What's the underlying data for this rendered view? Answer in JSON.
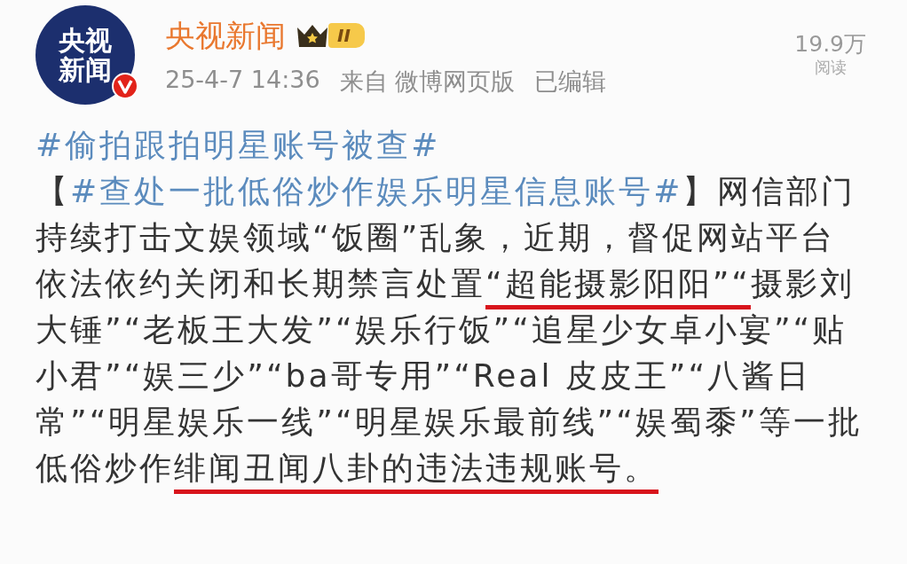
{
  "post": {
    "author": {
      "avatar_text": "央视新闻",
      "verified": true,
      "name": "央视新闻",
      "level": "II"
    },
    "meta": {
      "time": "25-4-7 14:36",
      "source": "来自 微博网页版",
      "edited": "已编辑"
    },
    "reads": {
      "count": "19.9万",
      "label": "阅读"
    },
    "body": [
      {
        "kind": "hashtag",
        "text": "#偷拍跟拍明星账号被查#"
      },
      {
        "kind": "text",
        "text": "【"
      },
      {
        "kind": "hashtag",
        "text": "#查处一批低俗炒作娱乐明星信息账号#"
      },
      {
        "kind": "text",
        "text": "】网信部门持续打击文娱领域“饭圈”乱象，近期，督促网站平台依法依约关闭和长期禁言处置"
      },
      {
        "kind": "text",
        "text": "“超能摄影阳阳”“",
        "underlined": true
      },
      {
        "kind": "text",
        "text": "摄影刘大锤”“老板王大发”“娱乐行饭”“追星少女卓小宴”“贴小君”“娱三少”“ba哥专用”“Real 皮皮王”“八酱日常”“明星娱乐一线”“明星娱乐最前线”“娱蜀黍”等一批低俗炒作"
      },
      {
        "kind": "text",
        "text": "绯闻丑闻八卦的违法违规账号。",
        "underlined": true
      }
    ]
  }
}
